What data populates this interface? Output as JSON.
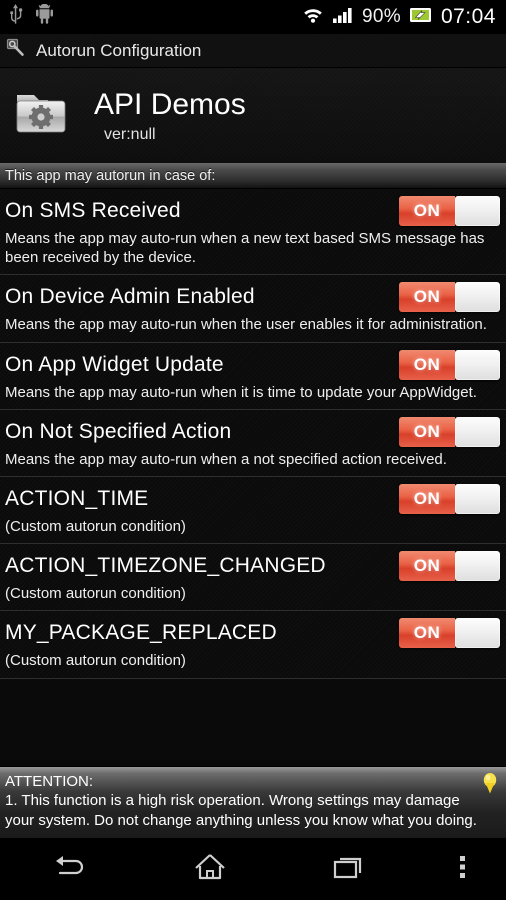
{
  "status_bar": {
    "icons": [
      "usb-icon",
      "android-robot-icon",
      "wifi-icon",
      "signal-icon",
      "battery-charging-icon"
    ],
    "battery_percent": "90%",
    "clock": "07:04"
  },
  "action_bar": {
    "icon": "search-icon",
    "title": "Autorun Configuration"
  },
  "app_header": {
    "icon": "folder-gear-icon",
    "title": "API Demos",
    "version": "ver:null"
  },
  "section_header": {
    "label": "This app may autorun in case of:"
  },
  "toggle_colors": {
    "on_fill": "#e8624a",
    "on_text": "#ffffff",
    "thumb": "#f1f1f1"
  },
  "rows": [
    {
      "title": "On SMS Received",
      "desc": "Means the app may auto-run when a new text based SMS message has been received by the device.",
      "toggle_label": "ON",
      "toggle_state": "on"
    },
    {
      "title": "On Device Admin Enabled",
      "desc": "Means the app may auto-run when the user enables it for administration.",
      "toggle_label": "ON",
      "toggle_state": "on"
    },
    {
      "title": "On App Widget Update",
      "desc": "Means the app may auto-run when it is time to update your AppWidget.",
      "toggle_label": "ON",
      "toggle_state": "on"
    },
    {
      "title": "On Not Specified Action",
      "desc": "Means the app may auto-run when a not specified action received.",
      "toggle_label": "ON",
      "toggle_state": "on"
    },
    {
      "title": "ACTION_TIME",
      "desc": "(Custom autorun condition)",
      "toggle_label": "ON",
      "toggle_state": "on"
    },
    {
      "title": "ACTION_TIMEZONE_CHANGED",
      "desc": "(Custom autorun condition)",
      "toggle_label": "ON",
      "toggle_state": "on"
    },
    {
      "title": "MY_PACKAGE_REPLACED",
      "desc": "(Custom autorun condition)",
      "toggle_label": "ON",
      "toggle_state": "on"
    }
  ],
  "attention": {
    "heading": "ATTENTION:",
    "body": "1. This function is a high risk operation. Wrong settings may damage your system. Do not change anything unless you know what you doing.",
    "icon": "lightbulb-icon",
    "icon_color": "#f5d623"
  },
  "nav_bar": {
    "buttons": [
      {
        "name": "back-button",
        "icon": "back-arrow-icon"
      },
      {
        "name": "home-button",
        "icon": "home-icon"
      },
      {
        "name": "recents-button",
        "icon": "recents-icon"
      },
      {
        "name": "overflow-button",
        "icon": "overflow-menu-icon"
      }
    ]
  }
}
